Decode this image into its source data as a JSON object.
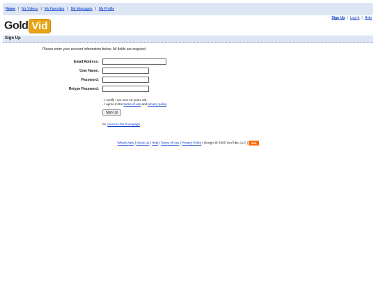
{
  "topnav": {
    "home": "Home",
    "my_videos": "My Videos",
    "my_favorites": "My Favorites",
    "my_messages": "My Messages",
    "my_profile": "My Profile",
    "separator": "|"
  },
  "logo": {
    "part1": "Gold",
    "part2": "Vid"
  },
  "userlinks": {
    "sign_up": "Sign Up",
    "log_in": "Log In",
    "help": "Help",
    "separator": "|"
  },
  "section_title": "Sign Up",
  "intro": "Please enter your account information below. All fields are required.",
  "form": {
    "email_label": "Email Address:",
    "username_label": "User Name:",
    "password_label": "Password:",
    "retype_label": "Retype Password:",
    "email_value": "",
    "username_value": "",
    "password_value": "",
    "retype_value": ""
  },
  "certify": {
    "line1": "- I certify I am over 13 years old.",
    "line2_prefix": "- I agree to the ",
    "terms_link": "terms of use",
    "and": " and ",
    "privacy_link": "privacy policy",
    "period": "."
  },
  "signup_button": "Sign Up",
  "return": {
    "prefix": "Or, ",
    "link": "return to the homepage",
    "suffix": "."
  },
  "footer": {
    "whats_new": "What's New",
    "about_us": "About Us",
    "help": "Help",
    "terms": "Terms of Use",
    "privacy": "Privacy Policy",
    "copyright": "Design @ 2005 YouTube, LLC",
    "separator": "|",
    "rss": "RSS"
  }
}
